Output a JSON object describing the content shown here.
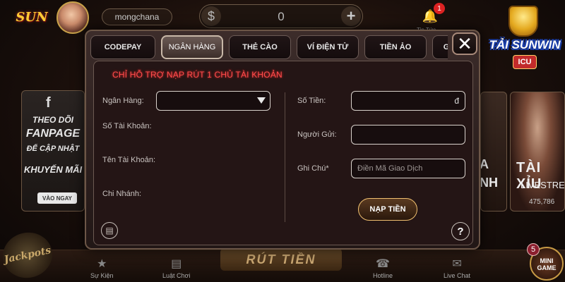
{
  "header": {
    "logo": "SUN",
    "username": "mongchana",
    "balance_symbol": "$",
    "balance": "0",
    "plus_symbol": "+",
    "bell_icon": "bell-icon",
    "notification_count": "1",
    "bell_label": "Tin Tức"
  },
  "brand": {
    "title": "TẢI SUNWIN",
    "sub": "ICU"
  },
  "promo_left": {
    "icon": "f",
    "lines": [
      "THEO DÕI",
      "FANPAGE",
      "ĐỂ CẬP NHẬT",
      "KHUYẾN MÃI"
    ],
    "button": "VÀO NGAY"
  },
  "promo_right": {
    "partial_lines": [
      "A",
      "NH"
    ],
    "title": "TÀI XỈU",
    "subtitle": "LIVESTREAM",
    "count": "475,786"
  },
  "dialog": {
    "tabs": [
      {
        "label": "CODEPAY",
        "active": false
      },
      {
        "label": "NGÂN HÀNG",
        "active": true
      },
      {
        "label": "THẺ CÀO",
        "active": false
      },
      {
        "label": "VÍ ĐIỆN TỬ",
        "active": false
      },
      {
        "label": "TIỀN ẢO",
        "active": false
      },
      {
        "label": "G",
        "active": false
      }
    ],
    "close_label": "✕",
    "notice": "CHỈ HỖ TRỢ NẠP RÚT 1 CHỦ TÀI KHOẢN",
    "left_form": {
      "bank_label": "Ngân Hàng:",
      "bank_value": "",
      "account_number_label": "Số Tài Khoản:",
      "account_name_label": "Tên Tài Khoản:",
      "branch_label": "Chi Nhánh:"
    },
    "right_form": {
      "amount_label": "Số Tiền:",
      "amount_currency": "đ",
      "sender_label": "Người Gửi:",
      "note_label": "Ghi Chú*",
      "note_placeholder": "Điền Mã Giao Dịch",
      "submit_label": "NẠP TIỀN"
    },
    "history_icon": "receipt-icon",
    "help_label": "?"
  },
  "bottom_nav": {
    "jackpot": "Jackpots",
    "items": [
      {
        "label": "Sự Kiện",
        "icon": "event-icon"
      },
      {
        "label": "Luật Chơi",
        "icon": "rules-icon"
      },
      {
        "label": "Hotline",
        "icon": "phone-icon"
      },
      {
        "label": "Live Chat",
        "icon": "chat-icon"
      }
    ],
    "withdraw_label": "RÚT TIỀN",
    "mini_game_label": "MINI GAME",
    "mini_game_badge": "5"
  }
}
